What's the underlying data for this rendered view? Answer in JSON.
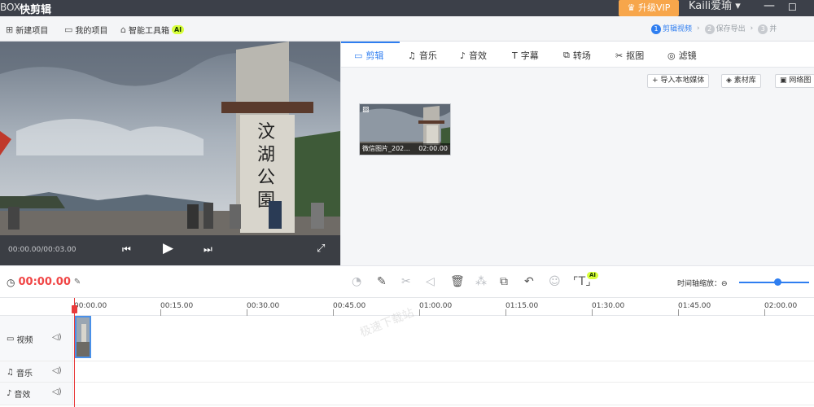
{
  "titlebar": {
    "logo_text": "BOX",
    "app_title": "快剪辑",
    "vip_label": "升级VIP",
    "user_name": "Kaili爱瑜",
    "minimize_glyph": "—",
    "maximize_glyph": "☐"
  },
  "toolbar": {
    "new_project": "新建项目",
    "my_projects": "我的项目",
    "smart_tools": "智能工具箱",
    "ai_badge": "AI",
    "steps": [
      {
        "num": "1",
        "label": "剪辑视频"
      },
      {
        "num": "2",
        "label": "保存导出"
      },
      {
        "num": "3",
        "label": "并"
      }
    ]
  },
  "preview": {
    "timecode": "00:00.00/00:03.00",
    "sign_text": "汶湖公園"
  },
  "media_tabs": [
    {
      "label": "剪辑",
      "icon": "video-icon"
    },
    {
      "label": "音乐",
      "icon": "music-icon"
    },
    {
      "label": "音效",
      "icon": "sound-effect-icon"
    },
    {
      "label": "字幕",
      "icon": "text-icon"
    },
    {
      "label": "转场",
      "icon": "transition-icon"
    },
    {
      "label": "抠图",
      "icon": "cutout-icon"
    },
    {
      "label": "滤镜",
      "icon": "filter-icon"
    }
  ],
  "media_buttons": {
    "import_local": "+ 导入本地媒体",
    "library": "素材库",
    "web_image": "网络图"
  },
  "thumbnail": {
    "name": "微信图片_202...",
    "duration": "02:00.00"
  },
  "edit_bar": {
    "current_time": "00:00.00",
    "zoom_label": "时间轴缩放：⊖",
    "zoom_level": 0.55,
    "ai_badge": "AI"
  },
  "ruler": [
    "00:00.00",
    "00:15.00",
    "00:30.00",
    "00:45.00",
    "01:00.00",
    "01:15.00",
    "01:30.00",
    "01:45.00",
    "02:00.00"
  ],
  "tracks": [
    {
      "label": "视频",
      "icon": "video-track-icon"
    },
    {
      "label": "音乐",
      "icon": "music-track-icon"
    },
    {
      "label": "音效",
      "icon": "sfx-track-icon"
    }
  ],
  "watermark": "极速下载站",
  "colors": {
    "accent": "#2f7ef0",
    "vip": "#f7a64b",
    "time_red": "#f04545",
    "titlebar": "#3c4049"
  }
}
